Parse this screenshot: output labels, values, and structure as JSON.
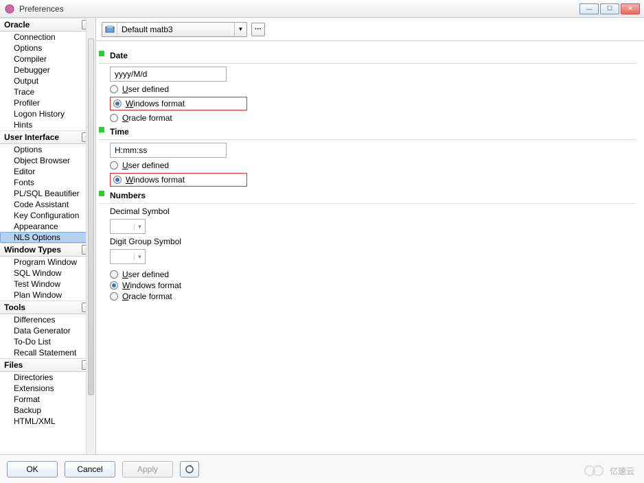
{
  "window": {
    "title": "Preferences"
  },
  "sidebar": {
    "categories": [
      {
        "name": "Oracle",
        "items": [
          "Connection",
          "Options",
          "Compiler",
          "Debugger",
          "Output",
          "Trace",
          "Profiler",
          "Logon History",
          "Hints"
        ]
      },
      {
        "name": "User Interface",
        "items": [
          "Options",
          "Object Browser",
          "Editor",
          "Fonts",
          "PL/SQL Beautifier",
          "Code Assistant",
          "Key Configuration",
          "Appearance",
          "NLS Options"
        ],
        "selected": "NLS Options"
      },
      {
        "name": "Window Types",
        "items": [
          "Program Window",
          "SQL Window",
          "Test Window",
          "Plan Window"
        ]
      },
      {
        "name": "Tools",
        "items": [
          "Differences",
          "Data Generator",
          "To-Do List",
          "Recall Statement"
        ]
      },
      {
        "name": "Files",
        "items": [
          "Directories",
          "Extensions",
          "Format",
          "Backup",
          "HTML/XML"
        ]
      }
    ]
  },
  "toolbar": {
    "preset": "Default matb3"
  },
  "sections": {
    "date": {
      "title": "Date",
      "value": "yyyy/M/d",
      "options": {
        "user": "User defined",
        "windows": "Windows format",
        "oracle": "Oracle format"
      },
      "selected": "windows"
    },
    "time": {
      "title": "Time",
      "value": "H:mm:ss",
      "options": {
        "user": "User defined",
        "windows": "Windows format"
      },
      "selected": "windows"
    },
    "numbers": {
      "title": "Numbers",
      "decimal_label": "Decimal Symbol",
      "decimal_value": "",
      "group_label": "Digit Group Symbol",
      "group_value": "",
      "options": {
        "user": "User defined",
        "windows": "Windows format",
        "oracle": "Oracle format"
      },
      "selected": "windows"
    }
  },
  "footer": {
    "ok": "OK",
    "cancel": "Cancel",
    "apply": "Apply"
  },
  "watermark": "亿速云"
}
